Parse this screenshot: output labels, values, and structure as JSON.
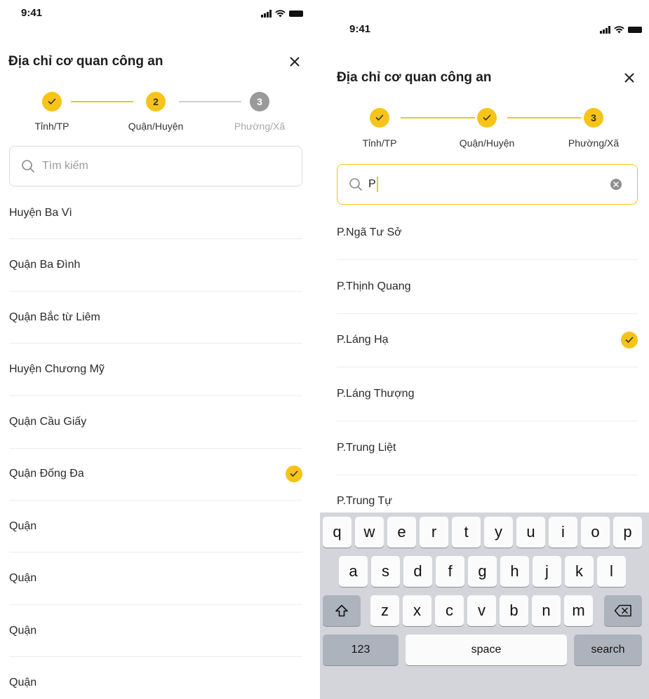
{
  "status_time": "9:41",
  "accent_color": "#f6c419",
  "screen1": {
    "title": "Địa chỉ cơ quan công an",
    "steps": [
      {
        "label": "Tỉnh/TP",
        "state": "done",
        "number": ""
      },
      {
        "label": "Quận/Huyện",
        "state": "current",
        "number": "2"
      },
      {
        "label": "Phường/Xã",
        "state": "pending",
        "number": "3"
      }
    ],
    "search_placeholder": "Tìm kiếm",
    "items": [
      {
        "label": "Huyện Ba Vì",
        "selected": false
      },
      {
        "label": "Quận Ba Đình",
        "selected": false
      },
      {
        "label": "Quận Bắc từ Liêm",
        "selected": false
      },
      {
        "label": "Huyện Chương Mỹ",
        "selected": false
      },
      {
        "label": "Quận Cầu Giấy",
        "selected": false
      },
      {
        "label": "Quận Đống Đa",
        "selected": true
      },
      {
        "label": "Quận",
        "selected": false
      },
      {
        "label": "Quận",
        "selected": false
      },
      {
        "label": "Quận",
        "selected": false
      },
      {
        "label": "Quận",
        "selected": false
      }
    ]
  },
  "screen2": {
    "title": "Địa chỉ cơ quan công an",
    "steps": [
      {
        "label": "Tỉnh/TP",
        "state": "done",
        "number": ""
      },
      {
        "label": "Quận/Huyện",
        "state": "done",
        "number": ""
      },
      {
        "label": "Phường/Xã",
        "state": "current",
        "number": "3"
      }
    ],
    "search_value": "P",
    "items": [
      {
        "label": "P.Ngã Tư Sở",
        "selected": false
      },
      {
        "label": "P.Thịnh Quang",
        "selected": false
      },
      {
        "label": "P.Láng Hạ",
        "selected": true
      },
      {
        "label": "P.Láng Thượng",
        "selected": false
      },
      {
        "label": "P.Trung Liệt",
        "selected": false
      },
      {
        "label": "P.Trung Tự",
        "selected": false
      }
    ]
  },
  "keyboard": {
    "row1": [
      "q",
      "w",
      "e",
      "r",
      "t",
      "y",
      "u",
      "i",
      "o",
      "p"
    ],
    "row2": [
      "a",
      "s",
      "d",
      "f",
      "g",
      "h",
      "j",
      "k",
      "l"
    ],
    "row3": [
      "z",
      "x",
      "c",
      "v",
      "b",
      "n",
      "m"
    ],
    "numbers_label": "123",
    "space_label": "space",
    "search_label": "search"
  }
}
